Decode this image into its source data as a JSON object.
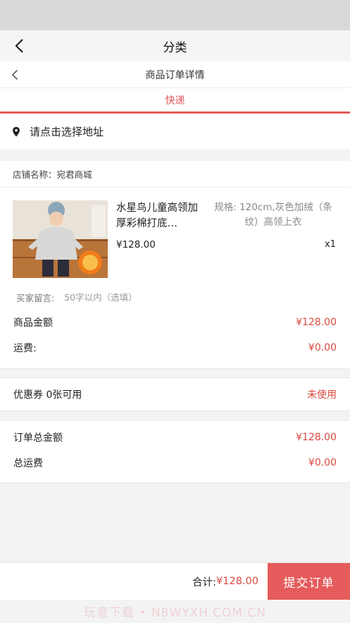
{
  "nav": {
    "title": "分类"
  },
  "sub_header": {
    "title": "商品订单详情"
  },
  "delivery": {
    "tab_label": "快递",
    "accent_color": "#e0595b"
  },
  "address": {
    "prompt": "请点击选择地址"
  },
  "shop": {
    "label": "店铺名称：宛君商城"
  },
  "product": {
    "name": "水星鸟儿童高领加厚彩棉打底…",
    "spec": "规格: 120cm,灰色加绒（条纹）高领上衣",
    "price": "¥128.00",
    "qty": "x1",
    "thumb_tag": "灰色条纹加绒"
  },
  "remark": {
    "label": "买家留言:",
    "placeholder": "50字以内（选填）"
  },
  "amounts": {
    "goods_label": "商品金额",
    "goods_value": "¥128.00",
    "shipping_label": "运费:",
    "shipping_value": "¥0.00"
  },
  "coupon": {
    "label": "优惠券 0张可用",
    "status": "未使用"
  },
  "totals": {
    "order_total_label": "订单总金额",
    "order_total_value": "¥128.00",
    "shipping_total_label": "总运费",
    "shipping_total_value": "¥0.00"
  },
  "footer": {
    "sum_label": "合计:",
    "sum_value": "¥128.00",
    "submit_label": "提交订单"
  },
  "watermark": "玩意下载 • N8WYXH.COM.CN"
}
